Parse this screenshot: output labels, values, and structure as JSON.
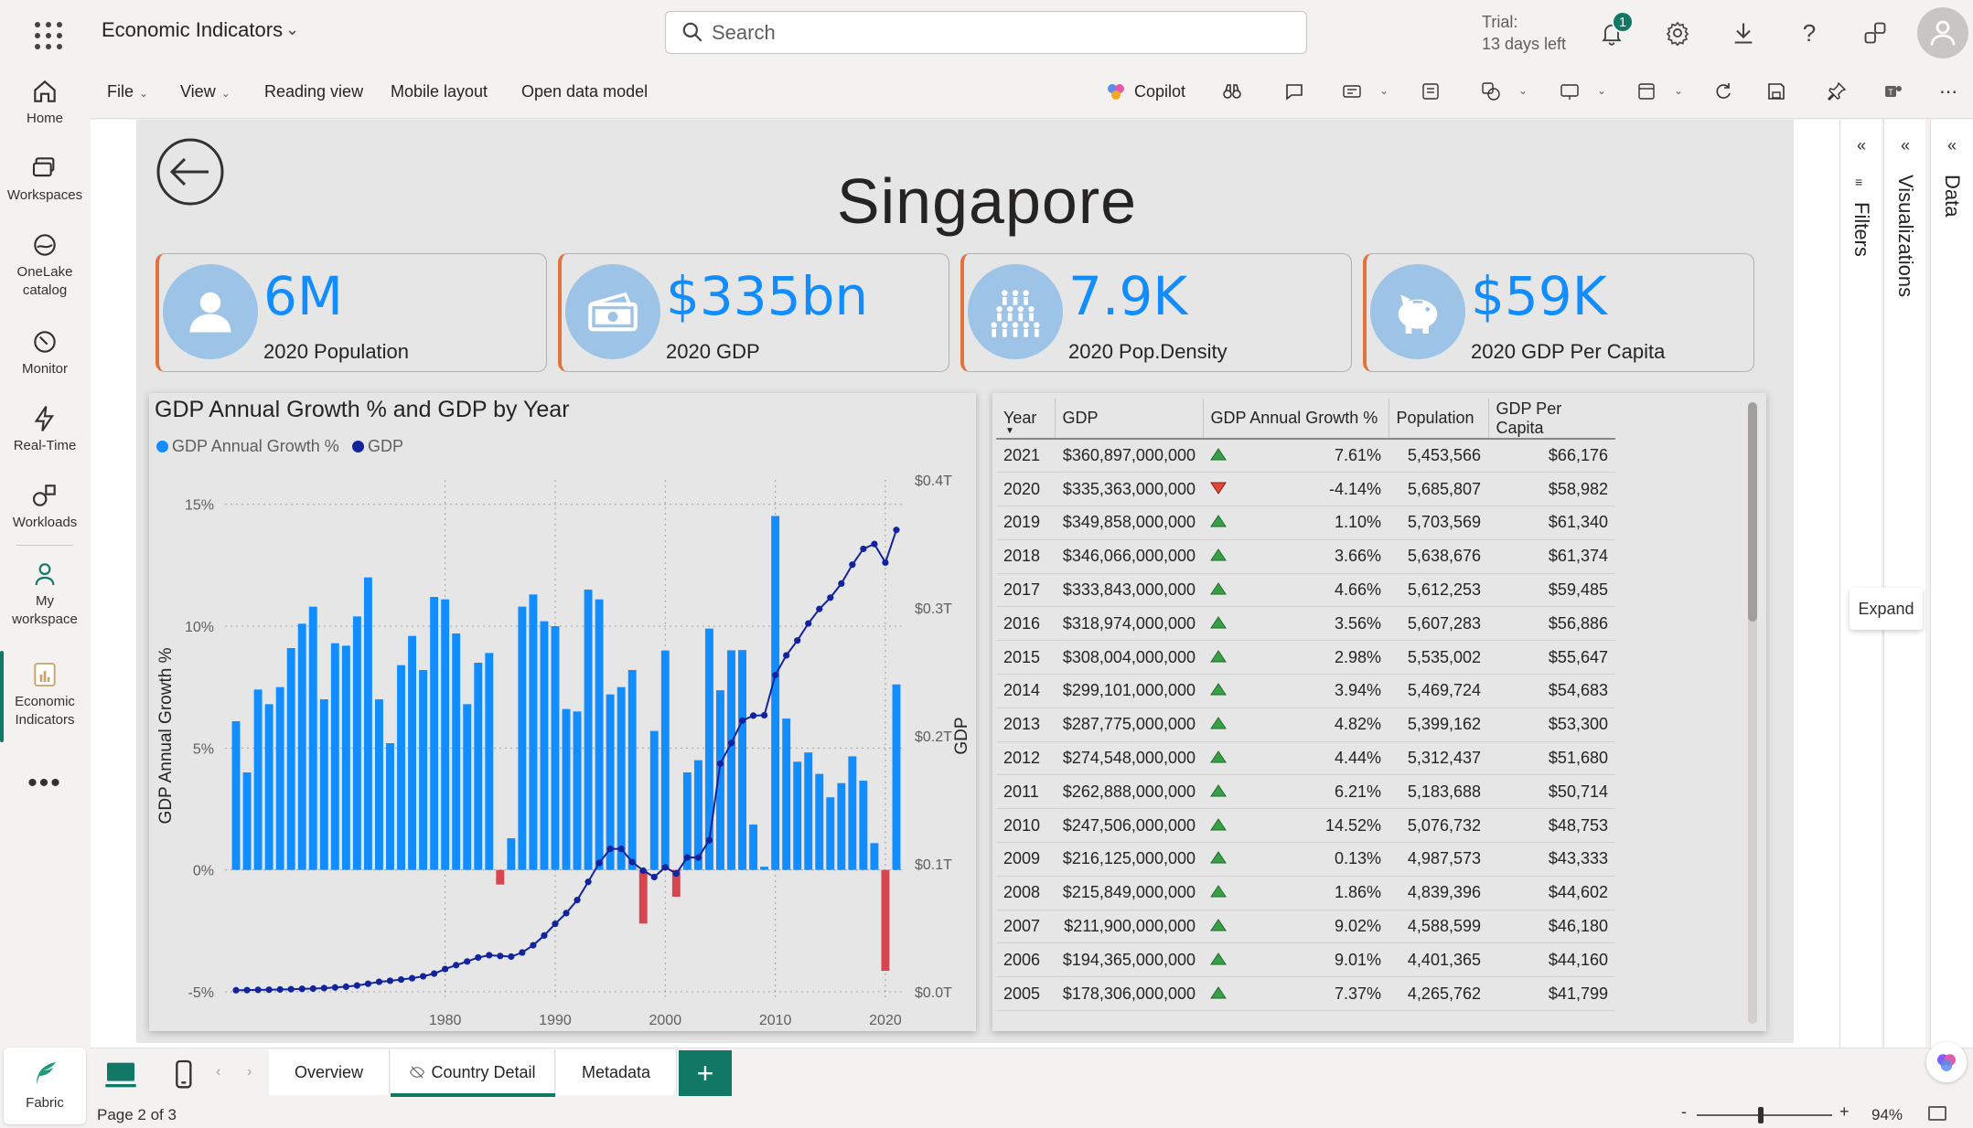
{
  "app": {
    "title": "Economic Indicators"
  },
  "search": {
    "placeholder": "Search"
  },
  "trial": {
    "line1": "Trial:",
    "line2": "13 days left"
  },
  "notifications": {
    "count": "1"
  },
  "nav": {
    "items": [
      {
        "label": "Home"
      },
      {
        "label": "Workspaces"
      },
      {
        "label": "OneLake",
        "label2": "catalog"
      },
      {
        "label": "Monitor"
      },
      {
        "label": "Real-Time"
      },
      {
        "label": "Workloads"
      },
      {
        "label": "My",
        "label2": "workspace"
      },
      {
        "label": "Economic",
        "label2": "Indicators"
      }
    ],
    "more": "•••",
    "fabric": "Fabric"
  },
  "toolbar": {
    "file": "File",
    "view": "View",
    "reading_view": "Reading view",
    "mobile_layout": "Mobile layout",
    "open_data_model": "Open data model",
    "copilot": "Copilot"
  },
  "report": {
    "country": "Singapore",
    "kpis": [
      {
        "value": "6M",
        "label": "2020 Population",
        "icon": "person-icon"
      },
      {
        "value": "$335bn",
        "label": "2020 GDP",
        "icon": "money-icon"
      },
      {
        "value": "7.9K",
        "label": "2020 Pop.Density",
        "icon": "crowd-icon"
      },
      {
        "value": "$59K",
        "label": "2020 GDP Per Capita",
        "icon": "piggy-bank-icon"
      }
    ]
  },
  "panes": {
    "filters": "Filters",
    "visualizations": "Visualizations",
    "data": "Data",
    "expand": "Expand"
  },
  "colors": {
    "accent": "#117865",
    "bar": "#118dff",
    "bar_negative": "#d64550",
    "line": "#12239e",
    "kpi_border": "#e3733a"
  },
  "chart_data": {
    "type": "bar",
    "title": "GDP Annual Growth % and GDP by Year",
    "xlabel": "Year",
    "ylabel": "GDP Annual Growth %",
    "y2label": "GDP",
    "legend_position": "top-left",
    "grid": true,
    "x": [
      1961,
      1962,
      1963,
      1964,
      1965,
      1966,
      1967,
      1968,
      1969,
      1970,
      1971,
      1972,
      1973,
      1974,
      1975,
      1976,
      1977,
      1978,
      1979,
      1980,
      1981,
      1982,
      1983,
      1984,
      1985,
      1986,
      1987,
      1988,
      1989,
      1990,
      1991,
      1992,
      1993,
      1994,
      1995,
      1996,
      1997,
      1998,
      1999,
      2000,
      2001,
      2002,
      2003,
      2004,
      2005,
      2006,
      2007,
      2008,
      2009,
      2010,
      2011,
      2012,
      2013,
      2014,
      2015,
      2016,
      2017,
      2018,
      2019,
      2020,
      2021
    ],
    "xticks": [
      1980,
      1990,
      2000,
      2010,
      2020
    ],
    "xtick_labels": [
      "1980",
      "1990",
      "2000",
      "2010",
      "2020"
    ],
    "xlim": [
      1960,
      2021.5
    ],
    "ylim": [
      -5,
      16
    ],
    "yticks": [
      -5,
      0,
      5,
      10,
      15
    ],
    "ytick_labels": [
      "-5%",
      "0%",
      "5%",
      "10%",
      "15%"
    ],
    "y2lim": [
      0,
      0.4
    ],
    "y2ticks": [
      0,
      0.1,
      0.2,
      0.3,
      0.4
    ],
    "y2tick_labels": [
      "$0.0T",
      "$0.1T",
      "$0.2T",
      "$0.3T",
      "$0.4T"
    ],
    "series": [
      {
        "name": "GDP Annual Growth %",
        "axis": "left",
        "style": "bar",
        "values": [
          6.1,
          4.0,
          7.4,
          6.8,
          7.5,
          9.1,
          10.1,
          10.8,
          7.0,
          9.3,
          9.2,
          10.4,
          12.0,
          7.0,
          5.2,
          8.4,
          9.6,
          8.2,
          11.2,
          11.1,
          9.7,
          6.8,
          8.5,
          8.9,
          -0.6,
          1.3,
          10.8,
          11.3,
          10.2,
          10.0,
          6.6,
          6.5,
          11.5,
          11.1,
          7.2,
          7.5,
          8.2,
          -2.2,
          5.7,
          9.0,
          -1.1,
          4.0,
          4.5,
          9.9,
          7.37,
          9.01,
          9.02,
          1.86,
          0.13,
          14.52,
          6.21,
          4.44,
          4.82,
          3.94,
          2.98,
          3.56,
          4.66,
          3.66,
          1.1,
          -4.14,
          7.61
        ]
      },
      {
        "name": "GDP",
        "axis": "right",
        "style": "line",
        "values": [
          0.0012,
          0.0013,
          0.0015,
          0.0016,
          0.0018,
          0.002,
          0.0023,
          0.0025,
          0.0029,
          0.0034,
          0.004,
          0.0049,
          0.0063,
          0.0078,
          0.0086,
          0.0096,
          0.0106,
          0.0121,
          0.0142,
          0.0178,
          0.0208,
          0.0237,
          0.0268,
          0.0286,
          0.028,
          0.0275,
          0.0307,
          0.0364,
          0.044,
          0.0531,
          0.0615,
          0.0717,
          0.0859,
          0.1007,
          0.1117,
          0.1117,
          0.1014,
          0.0947,
          0.0897,
          0.0973,
          0.0924,
          0.105,
          0.1049,
          0.1185,
          0.1783,
          0.1944,
          0.2119,
          0.2158,
          0.2161,
          0.2475,
          0.2629,
          0.2745,
          0.2878,
          0.2991,
          0.308,
          0.319,
          0.3338,
          0.3461,
          0.3499,
          0.3354,
          0.3609
        ]
      }
    ]
  },
  "table": {
    "columns": [
      "Year",
      "GDP",
      "GDP Annual Growth %",
      "Population",
      "GDP Per Capita"
    ],
    "rows": [
      {
        "year": "2021",
        "gdp": "$360,897,000,000",
        "growth": "7.61%",
        "dir": "up",
        "pop": "5,453,566",
        "pc": "$66,176"
      },
      {
        "year": "2020",
        "gdp": "$335,363,000,000",
        "growth": "-4.14%",
        "dir": "down",
        "pop": "5,685,807",
        "pc": "$58,982"
      },
      {
        "year": "2019",
        "gdp": "$349,858,000,000",
        "growth": "1.10%",
        "dir": "up",
        "pop": "5,703,569",
        "pc": "$61,340"
      },
      {
        "year": "2018",
        "gdp": "$346,066,000,000",
        "growth": "3.66%",
        "dir": "up",
        "pop": "5,638,676",
        "pc": "$61,374"
      },
      {
        "year": "2017",
        "gdp": "$333,843,000,000",
        "growth": "4.66%",
        "dir": "up",
        "pop": "5,612,253",
        "pc": "$59,485"
      },
      {
        "year": "2016",
        "gdp": "$318,974,000,000",
        "growth": "3.56%",
        "dir": "up",
        "pop": "5,607,283",
        "pc": "$56,886"
      },
      {
        "year": "2015",
        "gdp": "$308,004,000,000",
        "growth": "2.98%",
        "dir": "up",
        "pop": "5,535,002",
        "pc": "$55,647"
      },
      {
        "year": "2014",
        "gdp": "$299,101,000,000",
        "growth": "3.94%",
        "dir": "up",
        "pop": "5,469,724",
        "pc": "$54,683"
      },
      {
        "year": "2013",
        "gdp": "$287,775,000,000",
        "growth": "4.82%",
        "dir": "up",
        "pop": "5,399,162",
        "pc": "$53,300"
      },
      {
        "year": "2012",
        "gdp": "$274,548,000,000",
        "growth": "4.44%",
        "dir": "up",
        "pop": "5,312,437",
        "pc": "$51,680"
      },
      {
        "year": "2011",
        "gdp": "$262,888,000,000",
        "growth": "6.21%",
        "dir": "up",
        "pop": "5,183,688",
        "pc": "$50,714"
      },
      {
        "year": "2010",
        "gdp": "$247,506,000,000",
        "growth": "14.52%",
        "dir": "up",
        "pop": "5,076,732",
        "pc": "$48,753"
      },
      {
        "year": "2009",
        "gdp": "$216,125,000,000",
        "growth": "0.13%",
        "dir": "up",
        "pop": "4,987,573",
        "pc": "$43,333"
      },
      {
        "year": "2008",
        "gdp": "$215,849,000,000",
        "growth": "1.86%",
        "dir": "up",
        "pop": "4,839,396",
        "pc": "$44,602"
      },
      {
        "year": "2007",
        "gdp": "$211,900,000,000",
        "growth": "9.02%",
        "dir": "up",
        "pop": "4,588,599",
        "pc": "$46,180"
      },
      {
        "year": "2006",
        "gdp": "$194,365,000,000",
        "growth": "9.01%",
        "dir": "up",
        "pop": "4,401,365",
        "pc": "$44,160"
      },
      {
        "year": "2005",
        "gdp": "$178,306,000,000",
        "growth": "7.37%",
        "dir": "up",
        "pop": "4,265,762",
        "pc": "$41,799"
      }
    ]
  },
  "pages": {
    "overview": "Overview",
    "country_detail": "Country Detail",
    "metadata": "Metadata",
    "add": "+"
  },
  "status": {
    "page": "Page 2 of 3",
    "zoom": "94%",
    "zoom_minus": "-",
    "zoom_plus": "+"
  }
}
